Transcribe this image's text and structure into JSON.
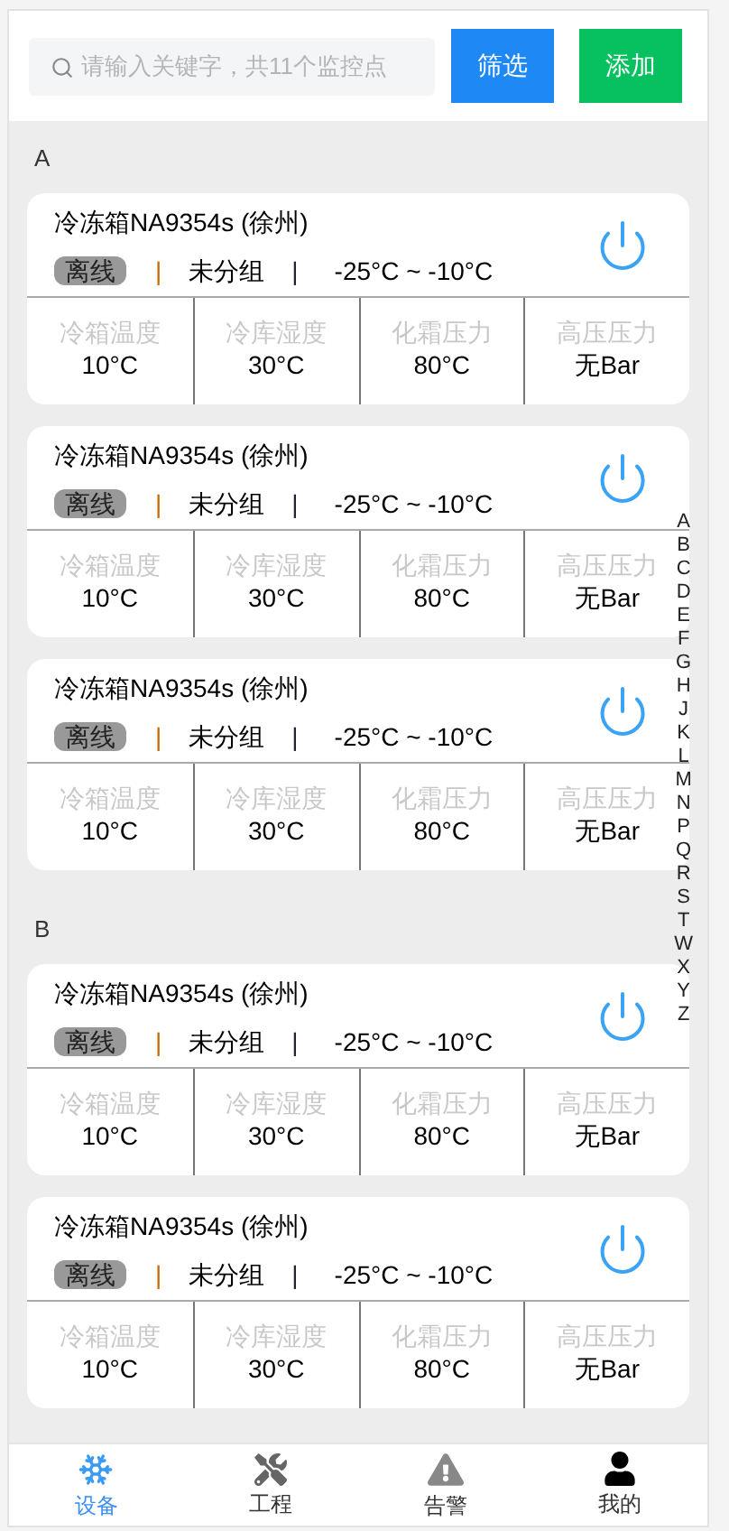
{
  "search": {
    "placeholder": "请输入关键字，共11个监控点"
  },
  "buttons": [
    {
      "kind": "filter",
      "label": "筛选"
    },
    {
      "kind": "add",
      "label": "添加"
    }
  ],
  "sections": [
    {
      "letter": "A",
      "devices": [
        {
          "name": "冷冻箱NA9354s (徐州)",
          "online": false,
          "status": "离线",
          "separator": "|",
          "group": "未分组",
          "range": "-25°C ~ -10°C",
          "metrics": [
            {
              "label": "冷箱温度",
              "value": "10°C"
            },
            {
              "label": "冷库湿度",
              "value": "30°C"
            },
            {
              "label": "化霜压力",
              "value": "80°C"
            },
            {
              "label": "高压压力",
              "value": "无Bar"
            }
          ]
        },
        {
          "name": "冷冻箱NA9354s (徐州)",
          "online": false,
          "status": "离线",
          "separator": "|",
          "group": "未分组",
          "range": "-25°C ~ -10°C",
          "metrics": [
            {
              "label": "冷箱温度",
              "value": "10°C"
            },
            {
              "label": "冷库湿度",
              "value": "30°C"
            },
            {
              "label": "化霜压力",
              "value": "80°C"
            },
            {
              "label": "高压压力",
              "value": "无Bar"
            }
          ]
        },
        {
          "name": "冷冻箱NA9354s (徐州)",
          "online": false,
          "status": "离线",
          "separator": "|",
          "group": "未分组",
          "range": "-25°C ~ -10°C",
          "metrics": [
            {
              "label": "冷箱温度",
              "value": "10°C"
            },
            {
              "label": "冷库湿度",
              "value": "30°C"
            },
            {
              "label": "化霜压力",
              "value": "80°C"
            },
            {
              "label": "高压压力",
              "value": "无Bar"
            }
          ]
        }
      ]
    },
    {
      "letter": "B",
      "devices": [
        {
          "name": "冷冻箱NA9354s (徐州)",
          "online": false,
          "status": "离线",
          "separator": "|",
          "group": "未分组",
          "range": "-25°C ~ -10°C",
          "metrics": [
            {
              "label": "冷箱温度",
              "value": "10°C"
            },
            {
              "label": "冷库湿度",
              "value": "30°C"
            },
            {
              "label": "化霜压力",
              "value": "80°C"
            },
            {
              "label": "高压压力",
              "value": "无Bar"
            }
          ]
        },
        {
          "name": "冷冻箱NA9354s (徐州)",
          "online": false,
          "status": "离线",
          "separator": "|",
          "group": "未分组",
          "range": "-25°C ~ -10°C",
          "metrics": [
            {
              "label": "冷箱温度",
              "value": "10°C"
            },
            {
              "label": "冷库湿度",
              "value": "30°C"
            },
            {
              "label": "化霜压力",
              "value": "80°C"
            },
            {
              "label": "高压压力",
              "value": "无Bar"
            }
          ]
        }
      ]
    }
  ],
  "index": [
    "A",
    "B",
    "C",
    "D",
    "E",
    "F",
    "G",
    "H",
    "J",
    "K",
    "L",
    "M",
    "N",
    "P",
    "Q",
    "R",
    "S",
    "T",
    "W",
    "X",
    "Y",
    "Z"
  ],
  "nav": [
    {
      "kind": "device",
      "label": "设备",
      "selected": true
    },
    {
      "kind": "project",
      "label": "工程",
      "selected": false
    },
    {
      "kind": "alarm",
      "label": "告警",
      "selected": false
    },
    {
      "kind": "mine",
      "label": "我的",
      "selected": false
    }
  ]
}
